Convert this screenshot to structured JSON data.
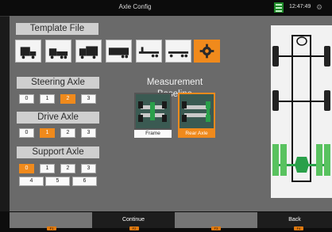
{
  "header": {
    "title": "Axle Config",
    "time": "12:47:49"
  },
  "template_file": {
    "label": "Template File"
  },
  "steering_axle": {
    "label": "Steering Axle",
    "options": [
      "0",
      "1",
      "2",
      "3"
    ],
    "selected": "2"
  },
  "drive_axle": {
    "label": "Drive Axle",
    "options": [
      "0",
      "1",
      "2",
      "3"
    ],
    "selected": "1"
  },
  "support_axle": {
    "label": "Support Axle",
    "options": [
      "0",
      "1",
      "2",
      "3",
      "4",
      "5",
      "6"
    ],
    "selected": "0"
  },
  "measurement_baseline": {
    "label": "Measurement Baseline",
    "options": [
      "Frame",
      "Rear Axle"
    ],
    "selected": "Rear Axle"
  },
  "footer": {
    "keys": [
      {
        "label": "",
        "badge": "F1"
      },
      {
        "label": "Continue",
        "badge": "F2"
      },
      {
        "label": "",
        "badge": "F3"
      },
      {
        "label": "Back",
        "badge": "F4"
      }
    ]
  },
  "colors": {
    "accent": "#f08a1c",
    "panel": "#6a6a6a",
    "topbar": "#0c0c0c",
    "status_green": "#1f8a2a"
  }
}
